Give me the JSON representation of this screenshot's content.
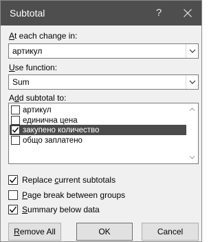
{
  "dialog": {
    "title": "Subtotal",
    "help_glyph": "?",
    "close_icon": "close-icon"
  },
  "change_label": {
    "pre": "",
    "key": "A",
    "post": "t each change in:"
  },
  "change_value": "артикул",
  "function_label": {
    "pre": "",
    "key": "U",
    "post": "se function:"
  },
  "function_value": "Sum",
  "add_label": {
    "pre": "A",
    "key": "d",
    "post": "d subtotal to:"
  },
  "add_items": [
    {
      "label": "артикул",
      "checked": false,
      "selected": false
    },
    {
      "label": "единична цена",
      "checked": false,
      "selected": false
    },
    {
      "label": "закупено количество",
      "checked": true,
      "selected": true
    },
    {
      "label": "общо заплатено",
      "checked": false,
      "selected": false
    }
  ],
  "options": {
    "replace": {
      "pre": "Replace ",
      "key": "c",
      "post": "urrent subtotals",
      "checked": true
    },
    "page_break": {
      "pre": "",
      "key": "P",
      "post": "age break between groups",
      "checked": false
    },
    "summary": {
      "pre": "",
      "key": "S",
      "post": "ummary below data",
      "checked": true
    }
  },
  "buttons": {
    "remove_all": {
      "pre": "",
      "key": "R",
      "post": "emove All"
    },
    "ok": "OK",
    "cancel": "Cancel"
  }
}
